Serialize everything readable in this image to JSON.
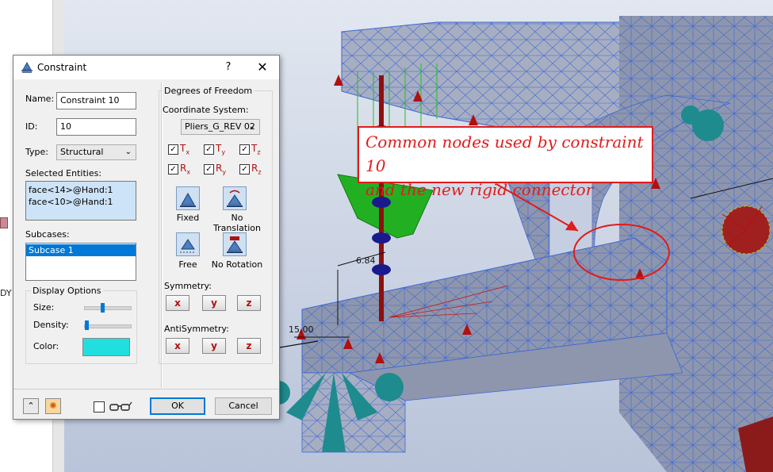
{
  "background": {
    "left_label": "DY"
  },
  "viewport": {
    "callout_lines": [
      "Common nodes used by constraint 10",
      "and the new rigid connector"
    ],
    "dim_label_1": "6.84",
    "dim_label_2": "15.00",
    "colors": {
      "sky": "#cdd6e6",
      "mesh": "#8e96ad",
      "mesh_lines": "#3b67d6",
      "constraint_red": "#b01010",
      "callout_red": "#e01c1c",
      "load_green": "#1fc21f",
      "spring_blue": "#1a1a8c",
      "cone_teal": "#1e8b8e"
    }
  },
  "dialog": {
    "title": "Constraint",
    "help": "?",
    "close": "✕",
    "name_label": "Name:",
    "name_value": "Constraint 10",
    "id_label": "ID:",
    "id_value": "10",
    "type_label": "Type:",
    "type_value": "Structural",
    "selected_entities_label": "Selected Entities:",
    "selected_entities": [
      "face<14>@Hand:1",
      "face<10>@Hand:1"
    ],
    "subcases_label": "Subcases:",
    "subcases": [
      "Subcase 1"
    ],
    "display_options": {
      "title": "Display Options",
      "size_label": "Size:",
      "size_value": 0.4,
      "density_label": "Density:",
      "density_value": 0.0,
      "color_label": "Color:",
      "color_value": "#22dede"
    },
    "dof": {
      "title": "Degrees of Freedom",
      "coord_label": "Coordinate System:",
      "coord_value": "Pliers_G_REV 02",
      "checks": [
        {
          "letter": "T",
          "sub": "x"
        },
        {
          "letter": "T",
          "sub": "y"
        },
        {
          "letter": "T",
          "sub": "z"
        },
        {
          "letter": "R",
          "sub": "x"
        },
        {
          "letter": "R",
          "sub": "y"
        },
        {
          "letter": "R",
          "sub": "z"
        }
      ],
      "check_mark": "✓",
      "presets": [
        "Fixed",
        "No Translation",
        "Free",
        "No Rotation"
      ],
      "symmetry_label": "Symmetry:",
      "antisymmetry_label": "AntiSymmetry:",
      "axis_buttons": [
        "x",
        "y",
        "z"
      ]
    },
    "ok_label": "OK",
    "cancel_label": "Cancel",
    "expand_glyph": "⌃",
    "glasses_icon": "glasses-icon"
  }
}
